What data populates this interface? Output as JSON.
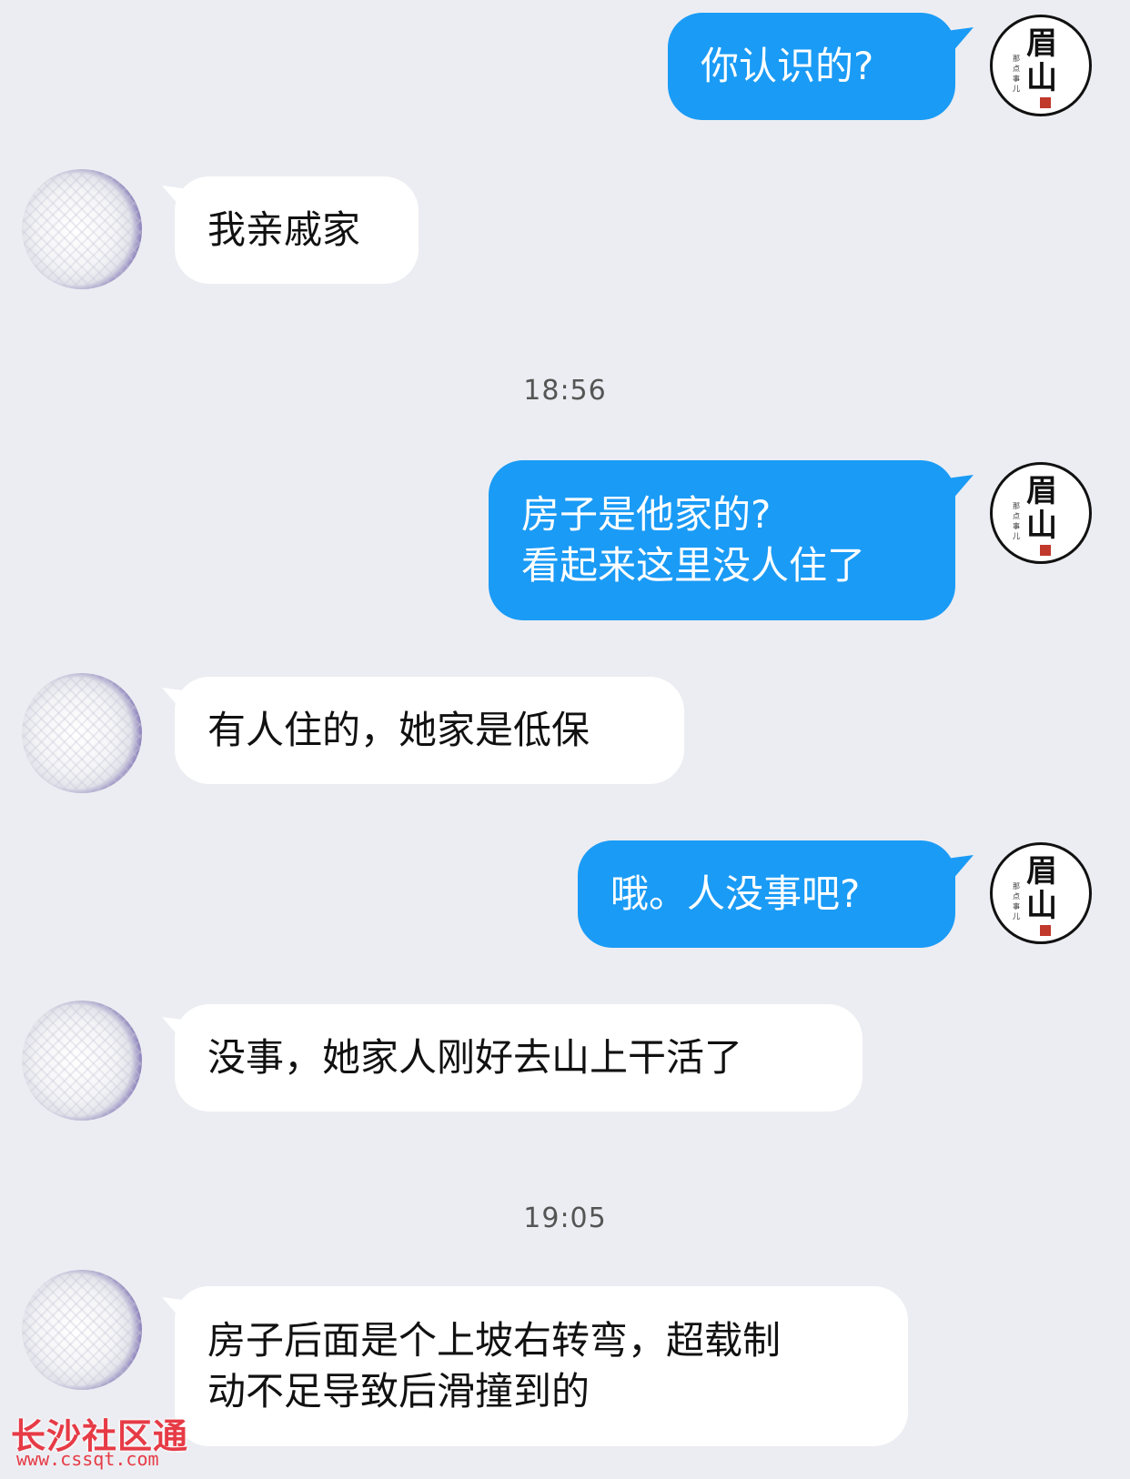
{
  "messages": [
    {
      "side": "out",
      "lines": [
        "你认识的?"
      ]
    },
    {
      "side": "in",
      "lines": [
        "我亲戚家"
      ]
    },
    {
      "side": "out",
      "lines": [
        "房子是他家的?",
        "看起来这里没人住了"
      ]
    },
    {
      "side": "in",
      "lines": [
        "有人住的，她家是低保"
      ]
    },
    {
      "side": "out",
      "lines": [
        "哦。人没事吧?"
      ]
    },
    {
      "side": "in",
      "lines": [
        "没事，她家人刚好去山上干活了"
      ]
    },
    {
      "side": "in",
      "lines": [
        "房子后面是个上坡右转弯，超载制",
        "动不足导致后滑撞到的"
      ]
    }
  ],
  "timestamps": [
    "18:56",
    "19:05"
  ],
  "my_avatar": {
    "big_text": "眉山",
    "small_text": "那点事儿"
  },
  "colors": {
    "outgoing_bubble": "#1a9bf6",
    "incoming_bubble": "#ffffff",
    "background": "#ecedf2",
    "watermark": "#e63b46"
  },
  "watermark": {
    "title": "长沙社区通",
    "url": "www.cssqt.com"
  }
}
